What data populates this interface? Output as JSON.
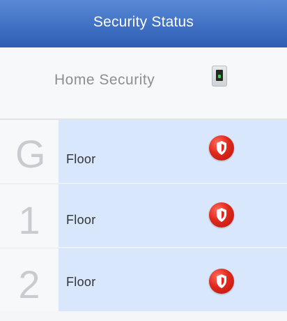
{
  "header": {
    "title": "Security Status"
  },
  "summary": {
    "label": "Home Security",
    "icon": "phone-status-icon"
  },
  "floors": [
    {
      "number": "G",
      "label": "Floor",
      "status_icon": "shield-alert-icon",
      "status_color": "#e0281c"
    },
    {
      "number": "1",
      "label": "Floor",
      "status_icon": "shield-alert-icon",
      "status_color": "#e0281c"
    },
    {
      "number": "2",
      "label": "Floor",
      "status_icon": "shield-alert-icon",
      "status_color": "#e0281c"
    }
  ],
  "colors": {
    "header": "#3f70c4",
    "row_highlight": "#d8e7fb",
    "alert": "#e0281c"
  }
}
